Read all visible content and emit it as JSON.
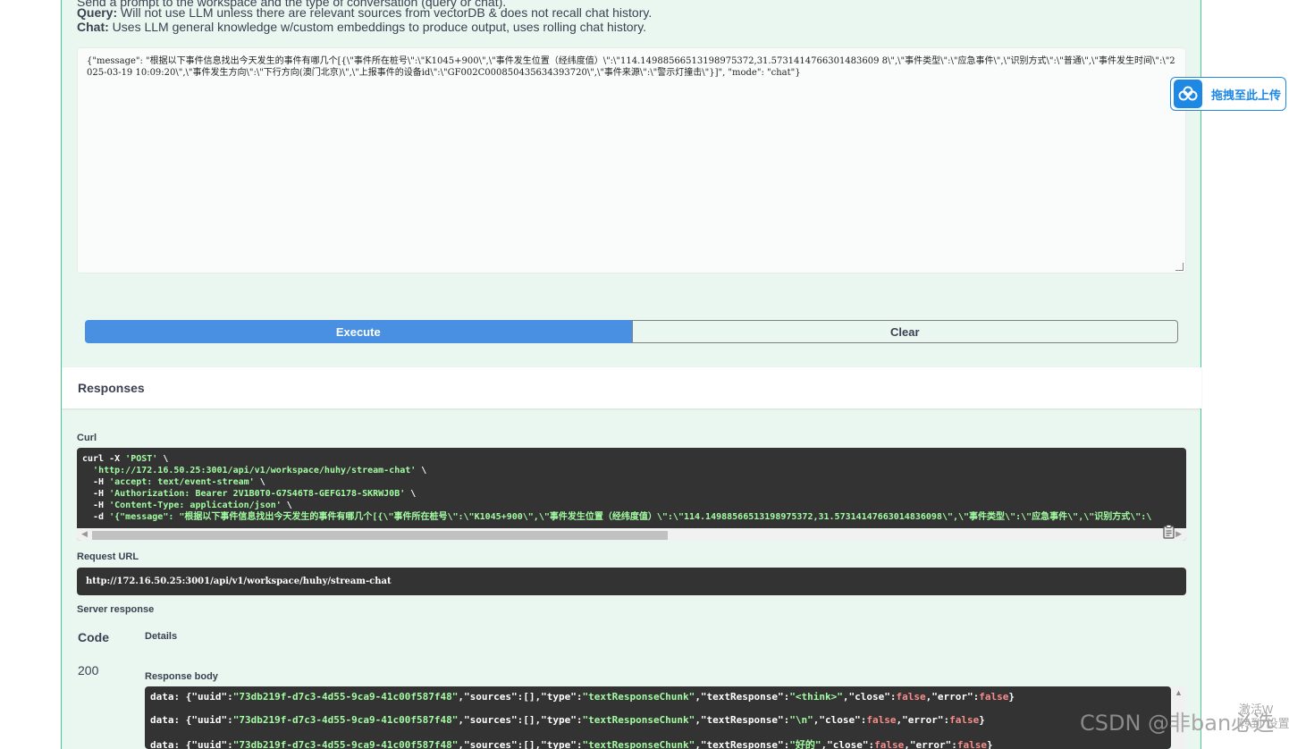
{
  "description": {
    "line0": "Send a prompt to the workspace and the type of conversation (query or chat).",
    "query_label": "Query:",
    "query_text": " Will not use LLM unless there are relevant sources from vectorDB & does not recall chat history.",
    "chat_label": "Chat:",
    "chat_text": " Uses LLM general knowledge w/custom embeddings to produce output, uses rolling chat history."
  },
  "request_body": "{\"message\": \"根据以下事件信息找出今天发生的事件有哪几个[{\\\"事件所在桩号\\\":\\\"K1045+900\\\",\\\"事件发生位置（经纬度值）\\\":\\\"114.14988566513198975372,31.5731414766301483609 8\\\",\\\"事件类型\\\":\\\"应急事件\\\",\\\"识别方式\\\":\\\"普通\\\",\\\"事件发生时间\\\":\\\"2025-03-19 10:09:20\\\",\\\"事件发生方向\\\":\\\"下行方向(澳门北京)\\\",\\\"上报事件的设备id\\\":\\\"GF002C000850435634393720\\\",\\\"事件来源\\\":\\\"警示灯撞击\\\"}]\", \"mode\": \"chat\"}",
  "buttons": {
    "execute": "Execute",
    "clear": "Clear"
  },
  "responses_title": "Responses",
  "curl": {
    "label": "Curl",
    "line1_cmd": "curl -X ",
    "line1_method": "'POST'",
    "line1_tail": " \\",
    "line2_url": "'http://172.16.50.25:3001/api/v1/workspace/huhy/stream-chat'",
    "line3_flag": "  -H ",
    "line3_val": "'accept: text/event-stream'",
    "line4_val": "'Authorization: Bearer 2V1B0T0-G7S46T8-GEFG178-SKRWJ0B'",
    "line5_val": "'Content-Type: application/json'",
    "line6_flag": "  -d ",
    "line6_val": "'{\"message\": \"根据以下事件信息找出今天发生的事件有哪几个[{\\\"事件所在桩号\\\":\\\"K1045+900\\\",\\\"事件发生位置（经纬度值）\\\":\\\"114.14988566513198975372,31.57314147663014836098\\\",\\\"事件类型\\\":\\\"应急事件\\\",\\\"识别方式\\\":\\"
  },
  "request_url": {
    "label": "Request URL",
    "value": "http://172.16.50.25:3001/api/v1/workspace/huhy/stream-chat"
  },
  "server_response": {
    "label": "Server response",
    "code_header": "Code",
    "details_header": "Details",
    "code": "200",
    "body_label": "Response body",
    "lines": [
      {
        "uuid": "\"73db219f-d7c3-4d55-9ca9-41c00f587f48\"",
        "type": "\"textResponseChunk\"",
        "textResponse": "\"<think>\""
      },
      {
        "uuid": "\"73db219f-d7c3-4d55-9ca9-41c00f587f48\"",
        "type": "\"textResponseChunk\"",
        "textResponse": "\"\\n\""
      },
      {
        "uuid": "\"73db219f-d7c3-4d55-9ca9-41c00f587f48\"",
        "type": "\"textResponseChunk\"",
        "textResponse": "\"好的\""
      }
    ],
    "prefix": "data: {\"uuid\":",
    "sources": ",\"sources\":[],\"type\":",
    "textResp_key": ",\"textResponse\":",
    "close_key": ",\"close\":",
    "false_val": "false",
    "error_key": ",\"error\":",
    "end": "}"
  },
  "upload_badge": {
    "label": "拖拽至此上传",
    "icon": "cloud-upload-icon"
  },
  "watermark": "CSDN @非ban必选",
  "activate_windows": {
    "line1": "激活W",
    "line2": "转到\"设置"
  },
  "colors": {
    "accent": "#4990e2",
    "panel_bg": "#eaf7f0",
    "border": "#49cc90",
    "code_bg": "#333333",
    "string": "#a2fca2",
    "boolean": "#fc8b8b"
  }
}
